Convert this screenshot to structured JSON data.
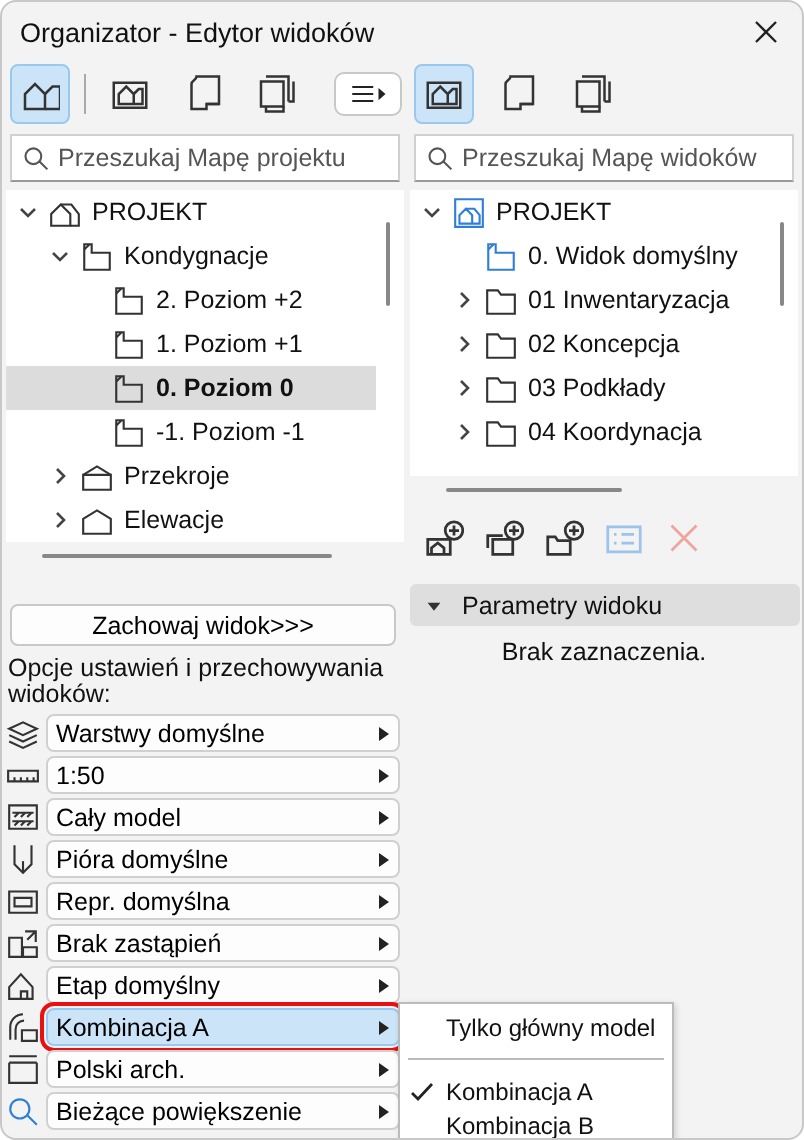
{
  "window": {
    "title": "Organizator - Edytor widoków"
  },
  "left_panel": {
    "toolbar": [
      {
        "kind": "project-map",
        "selected": true
      },
      {
        "kind": "view-map",
        "selected": false
      },
      {
        "kind": "layout-book",
        "selected": false
      },
      {
        "kind": "publisher",
        "selected": false
      }
    ],
    "menu_button": {
      "kind": "menu"
    },
    "search": {
      "placeholder": "Przeszukaj Mapę projektu"
    },
    "tree": [
      {
        "label": "PROJEKT",
        "kind": "project",
        "expanded": true,
        "selected": false,
        "children": [
          {
            "label": "Kondygnacje",
            "kind": "storeys",
            "expanded": true,
            "selected": false,
            "children": [
              {
                "label": "2. Poziom +2",
                "kind": "storey",
                "selected": false
              },
              {
                "label": "1. Poziom +1",
                "kind": "storey",
                "selected": false
              },
              {
                "label": "0. Poziom 0",
                "kind": "storey",
                "selected": true
              },
              {
                "label": "-1. Poziom -1",
                "kind": "storey",
                "selected": false
              }
            ]
          },
          {
            "label": "Przekroje",
            "kind": "section",
            "expanded": false,
            "selected": false
          },
          {
            "label": "Elewacje",
            "kind": "elevation",
            "expanded": false,
            "selected": false
          }
        ]
      }
    ],
    "save_button": "Zachowaj widok>>>",
    "options_label": "Opcje ustawień i przechowywania widoków:",
    "options": [
      {
        "kind": "layers",
        "label": "Warstwy domyślne",
        "selected": false
      },
      {
        "kind": "scale",
        "label": "1:50",
        "selected": false
      },
      {
        "kind": "model",
        "label": "Cały model",
        "selected": false
      },
      {
        "kind": "pens",
        "label": "Pióra domyślne",
        "selected": false
      },
      {
        "kind": "representation",
        "label": "Repr. domyślna",
        "selected": false
      },
      {
        "kind": "override",
        "label": "Brak zastąpień",
        "selected": false
      },
      {
        "kind": "phase",
        "label": "Etap domyślny",
        "selected": false
      },
      {
        "kind": "combination",
        "label": "Kombinacja A",
        "selected": true
      },
      {
        "kind": "dimension",
        "label": "Polski arch.",
        "selected": false
      },
      {
        "kind": "zoom",
        "label": "Bieżące powiększenie",
        "selected": false
      }
    ]
  },
  "right_panel": {
    "toolbar": [
      {
        "kind": "view-map",
        "selected": true
      },
      {
        "kind": "layout-book",
        "selected": false
      },
      {
        "kind": "publisher",
        "selected": false
      }
    ],
    "search": {
      "placeholder": "Przeszukaj Mapę widoków"
    },
    "tree": [
      {
        "label": "PROJEKT",
        "kind": "project-view",
        "expanded": true,
        "selected": false,
        "children": [
          {
            "label": "0. Widok domyślny",
            "kind": "view",
            "selected": false
          },
          {
            "label": "01 Inwentaryzacja",
            "kind": "folder",
            "expanded": false,
            "selected": false
          },
          {
            "label": "02 Koncepcja",
            "kind": "folder",
            "expanded": false,
            "selected": false
          },
          {
            "label": "03 Podkłady",
            "kind": "folder",
            "expanded": false,
            "selected": false
          },
          {
            "label": "04 Koordynacja",
            "kind": "folder",
            "expanded": false,
            "selected": false
          }
        ]
      }
    ],
    "actions": [
      {
        "kind": "new-view",
        "disabled": false
      },
      {
        "kind": "clone-view",
        "disabled": false
      },
      {
        "kind": "new-folder",
        "disabled": false
      },
      {
        "kind": "settings",
        "disabled": true
      },
      {
        "kind": "delete",
        "disabled": true
      }
    ],
    "parameters": {
      "title": "Parametry widoku",
      "expanded": true,
      "message": "Brak zaznaczenia."
    }
  },
  "popup_menu": {
    "items": [
      {
        "kind": "item",
        "label": "Tylko główny model",
        "checked": false
      },
      {
        "kind": "separator"
      },
      {
        "kind": "item",
        "label": "Kombinacja A",
        "checked": true
      },
      {
        "kind": "item",
        "label": "Kombinacja B",
        "checked": false
      }
    ]
  }
}
